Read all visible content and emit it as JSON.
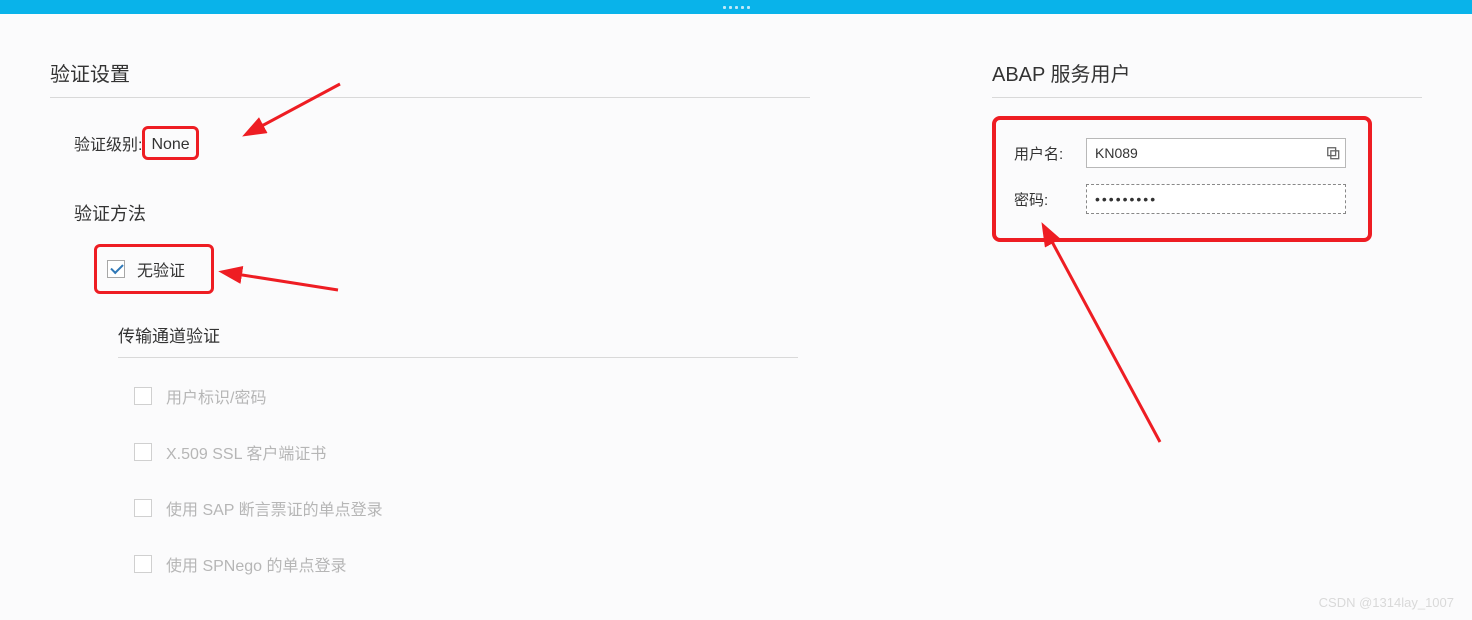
{
  "left": {
    "title": "验证设置",
    "level_label": "验证级别:",
    "level_value": "None",
    "method_title": "验证方法",
    "no_auth_label": "无验证",
    "no_auth_checked": true,
    "channel_title": "传输通道验证",
    "options": [
      "用户标识/密码",
      "X.509 SSL 客户端证书",
      "使用 SAP 断言票证的单点登录",
      "使用 SPNego 的单点登录"
    ]
  },
  "right": {
    "title": "ABAP 服务用户",
    "user_label": "用户名:",
    "user_value": "KN089",
    "pwd_label": "密码:",
    "pwd_value": "•••••••••"
  },
  "watermark": "CSDN @1314lay_1007"
}
